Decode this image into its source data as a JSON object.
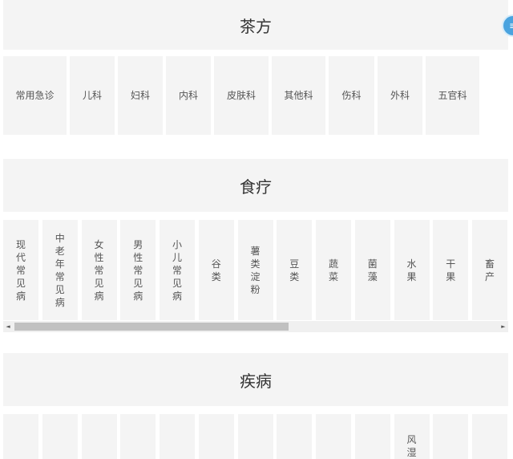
{
  "sections": {
    "tea": {
      "title": "茶方"
    },
    "diet": {
      "title": "食疗"
    },
    "disease": {
      "title": "疾病"
    }
  },
  "tea_items": [
    "常用急诊",
    "儿科",
    "妇科",
    "内科",
    "皮肤科",
    "其他科",
    "伤科",
    "外科",
    "五官科"
  ],
  "diet_items": [
    "现代常见病",
    "中老年常见病",
    "女性常见病",
    "男性常见病",
    "小儿常见病",
    "谷类",
    "薯类淀粉",
    "豆类",
    "蔬菜",
    "菌藻",
    "水果",
    "干果",
    "畜产"
  ],
  "disease_items": [
    "",
    "",
    "",
    "",
    "",
    "",
    "",
    "",
    "",
    "",
    "风湿",
    "",
    ""
  ],
  "scroll": {
    "left_arrow": "◄",
    "right_arrow": "►",
    "position": 0.0
  },
  "float_button": {
    "icon": "menu-icon",
    "glyph": "≡"
  },
  "colors": {
    "tile_bg": "#f4f4f4",
    "accent": "#4aa3df"
  }
}
